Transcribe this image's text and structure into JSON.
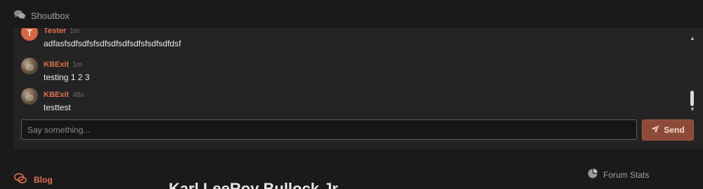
{
  "shoutbox": {
    "title": "Shoutbox",
    "messages": [
      {
        "username": "Tester",
        "timestamp": "1m",
        "avatar_letter": "T",
        "text": "adfasfsdfsdfsfsdfsdfsdfsdfsfsdfsdfdsf"
      },
      {
        "username": "KBExit",
        "timestamp": "1m",
        "text": "testing 1 2 3"
      },
      {
        "username": "KBExit",
        "timestamp": "48s",
        "text": "testtest"
      }
    ],
    "input": {
      "placeholder": "Say something...",
      "value": ""
    },
    "send_label": "Send"
  },
  "blog": {
    "title": "Blog",
    "post_title": "Karl LeeRoy Bullock Jr"
  },
  "forum_stats": {
    "title": "Forum Stats"
  },
  "colors": {
    "accent": "#e0704a",
    "send_button": "#8d4a38",
    "background": "#1a1a1a",
    "panel": "#232323"
  },
  "icons": {
    "shoutbox": "chat-bubbles-icon",
    "send": "paper-plane-icon",
    "blog": "chat-bubbles-icon",
    "forum_stats": "pie-chart-icon"
  }
}
